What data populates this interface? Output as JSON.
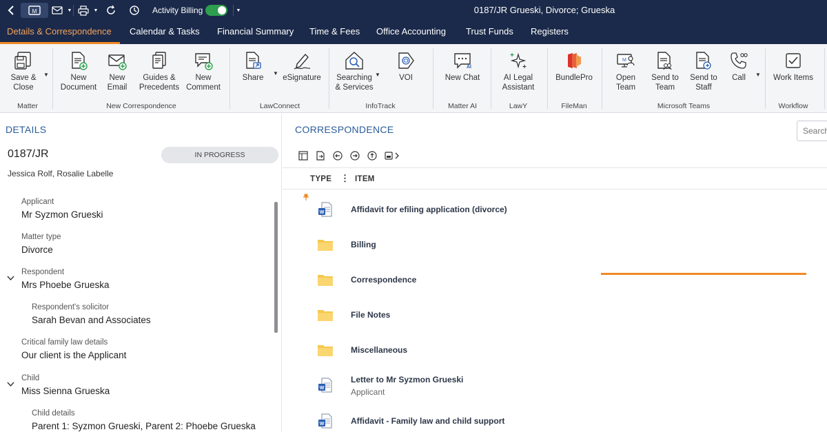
{
  "titlebar": {
    "activity_billing_label": "Activity Billing",
    "activity_billing_on": true,
    "window_title": "0187/JR Grueski, Divorce; Grueska"
  },
  "tabs": [
    {
      "label": "Details & Correspondence",
      "active": true
    },
    {
      "label": "Calendar & Tasks",
      "active": false
    },
    {
      "label": "Financial Summary",
      "active": false
    },
    {
      "label": "Time & Fees",
      "active": false
    },
    {
      "label": "Office Accounting",
      "active": false
    },
    {
      "label": "Trust Funds",
      "active": false
    },
    {
      "label": "Registers",
      "active": false
    }
  ],
  "ribbon": {
    "buttons": [
      {
        "label": "Save &\nClose",
        "icon": "save-close-icon"
      },
      {
        "label": "New\nDocument",
        "icon": "new-document-icon"
      },
      {
        "label": "New\nEmail",
        "icon": "new-email-icon"
      },
      {
        "label": "Guides &\nPrecedents",
        "icon": "guides-icon"
      },
      {
        "label": "New\nComment",
        "icon": "new-comment-icon"
      },
      {
        "label": "Share",
        "icon": "share-icon"
      },
      {
        "label": "eSignature",
        "icon": "esignature-icon"
      },
      {
        "label": "Searching\n& Services",
        "icon": "searching-services-icon"
      },
      {
        "label": "VOI",
        "icon": "voi-icon"
      },
      {
        "label": "New Chat",
        "icon": "ai-chat-icon"
      },
      {
        "label": "AI Legal\nAssistant",
        "icon": "ai-sparkle-icon"
      },
      {
        "label": "BundlePro",
        "icon": "bundlepro-icon"
      },
      {
        "label": "Open\nTeam",
        "icon": "open-team-icon"
      },
      {
        "label": "Send to\nTeam",
        "icon": "send-team-icon"
      },
      {
        "label": "Send to\nStaff",
        "icon": "send-staff-icon"
      },
      {
        "label": "Call",
        "icon": "call-icon"
      },
      {
        "label": "Work Items",
        "icon": "work-items-icon"
      }
    ],
    "groups": [
      "Matter",
      "New Correspondence",
      "LawConnect",
      "InfoTrack",
      "Matter AI",
      "LawY",
      "FileMan",
      "Microsoft  Teams",
      "Workflow"
    ]
  },
  "details": {
    "heading": "DETAILS",
    "matter_number": "0187/JR",
    "status": "IN PROGRESS",
    "staff": "Jessica Rolf, Rosalie Labelle",
    "fields": [
      {
        "label": "Applicant",
        "value": "Mr Syzmon Grueski"
      },
      {
        "label": "Matter type",
        "value": "Divorce"
      },
      {
        "label": "Respondent",
        "value": "Mrs Phoebe Grueska"
      },
      {
        "label": "Respondent's solicitor",
        "value": "Sarah Bevan and Associates"
      },
      {
        "label": "Critical family law details",
        "value": "Our client is the Applicant"
      },
      {
        "label": "Child",
        "value": "Miss Sienna Grueska"
      },
      {
        "label": "Child details",
        "value": "Parent 1: Syzmon Grueski, Parent 2: Phoebe Grueska"
      }
    ]
  },
  "correspondence": {
    "heading": "CORRESPONDENCE",
    "search_placeholder": "Search",
    "columns": {
      "type": "TYPE",
      "item": "ITEM"
    },
    "items": [
      {
        "name": "Affidavit for efiling application (divorce)",
        "sub": "",
        "kind": "word"
      },
      {
        "name": "Billing",
        "sub": "",
        "kind": "folder"
      },
      {
        "name": "Correspondence",
        "sub": "",
        "kind": "folder"
      },
      {
        "name": "File Notes",
        "sub": "",
        "kind": "folder"
      },
      {
        "name": "Miscellaneous",
        "sub": "",
        "kind": "folder"
      },
      {
        "name": "Letter to Mr Syzmon Grueski",
        "sub": "Applicant",
        "kind": "word"
      },
      {
        "name": "Affidavit - Family law and child support",
        "sub": "",
        "kind": "word"
      }
    ]
  },
  "colors": {
    "titlebar_bg": "#1b2a4a",
    "accent_orange": "#f08a24",
    "heading_blue": "#2a5c9a",
    "folder_yellow": "#f6c84c",
    "word_blue": "#2b5fb4"
  }
}
